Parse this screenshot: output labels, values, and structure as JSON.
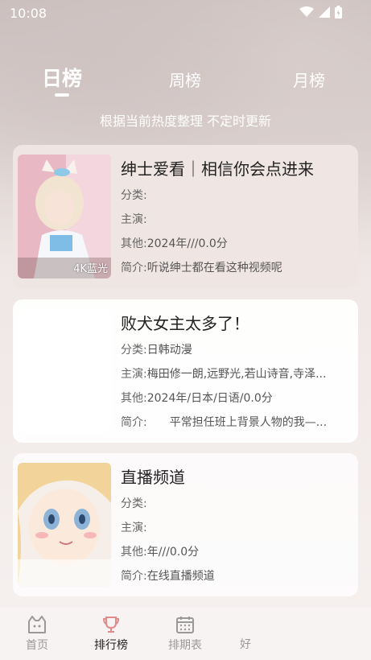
{
  "status_bar": {
    "time": "10:08"
  },
  "tabs": {
    "day": "日榜",
    "week": "周榜",
    "month": "月榜"
  },
  "subtitle": "根据当前热度整理 不定时更新",
  "items": [
    {
      "title": "绅士爱看｜相信你会点进来",
      "badge": "4K蓝光",
      "category_label": "分类:",
      "category": "",
      "cast_label": "主演:",
      "cast": "",
      "other_label": "其他:",
      "other": "2024年///0.0分",
      "intro_label": "简介:",
      "intro": "听说绅士都在看这种视频呢"
    },
    {
      "title": "败犬女主太多了！",
      "badge": "",
      "category_label": "分类:",
      "category": "日韩动漫",
      "cast_label": "主演:",
      "cast": "梅田修一朗,远野光,若山诗音,寺泽...",
      "other_label": "其他:",
      "other": "2024年/日本/日语/0.0分",
      "intro_label": "简介:",
      "intro": "　　平常担任班上背景人物的我—..."
    },
    {
      "title": "直播频道",
      "badge": "",
      "category_label": "分类:",
      "category": "",
      "cast_label": "主演:",
      "cast": "",
      "other_label": "其他:",
      "other": "年///0.0分",
      "intro_label": "简介:",
      "intro": "在线直播频道"
    }
  ],
  "bottom_nav": {
    "home": "首页",
    "ranking": "排行榜",
    "schedule": "排期表",
    "friends": "好"
  },
  "colors": {
    "active_nav": "#222222",
    "inactive_nav": "#999999",
    "ranking_icon": "#e08a8a"
  }
}
